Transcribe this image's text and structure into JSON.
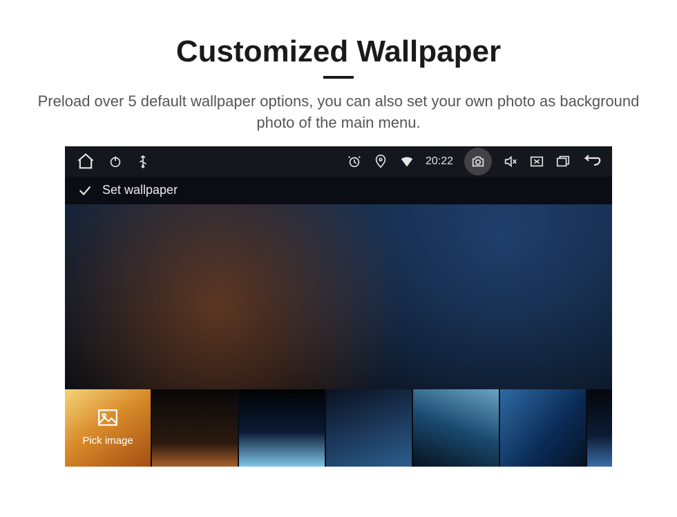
{
  "header": {
    "title": "Customized Wallpaper",
    "subtitle": "Preload over 5 default wallpaper options, you can also set your own photo as background photo of the main menu."
  },
  "statusbar": {
    "time": "20:22"
  },
  "screen": {
    "titlebar_label": "Set wallpaper"
  },
  "thumbs": {
    "pick_label": "Pick image"
  }
}
